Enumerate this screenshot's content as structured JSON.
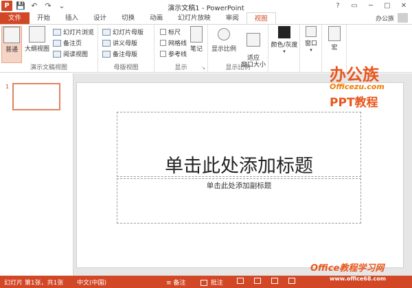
{
  "app": {
    "title": "演示文稿1 - PowerPoint",
    "logo": "P",
    "window_controls": [
      "?",
      "▭",
      "─",
      "□",
      "✕"
    ]
  },
  "qat": {
    "save_icon": "💾",
    "undo_icon": "↶",
    "redo_icon": "↷",
    "customize_icon": "⌄"
  },
  "tabs": [
    {
      "label": "文件"
    },
    {
      "label": "开始"
    },
    {
      "label": "插入"
    },
    {
      "label": "设计"
    },
    {
      "label": "切换"
    },
    {
      "label": "动画"
    },
    {
      "label": "幻灯片放映"
    },
    {
      "label": "审阅"
    },
    {
      "label": "视图"
    }
  ],
  "user": {
    "name": "办公族"
  },
  "ribbon": {
    "presentation_views": {
      "label": "演示文稿视图",
      "normal": "普通",
      "outline": "大纲视图",
      "slide_sorter": "幻灯片浏览",
      "notes_page": "备注页",
      "reading_view": "阅读视图"
    },
    "master_views": {
      "label": "母版视图",
      "slide_master": "幻灯片母版",
      "handout_master": "讲义母版",
      "notes_master": "备注母版"
    },
    "show": {
      "label": "显示",
      "ruler": "标尺",
      "gridlines": "网格线",
      "guides": "参考线",
      "notes": "笔记"
    },
    "zoom": {
      "label": "显示比例",
      "zoom": "显示比例",
      "fit_window": "适应\n窗口大小"
    },
    "color": {
      "label": "颜色/灰度"
    },
    "window": {
      "label": "窗口"
    },
    "macros": {
      "label": "宏"
    }
  },
  "thumbnails": {
    "slide_number": "1"
  },
  "slide": {
    "title_placeholder": "单击此处添加标题",
    "subtitle_placeholder": "单击此处添加副标题"
  },
  "watermark": {
    "brand_cn": "办公族",
    "brand_url": "Officezu.com",
    "ppt_label": "PPT教程",
    "bottom_brand": "Office教程学习网",
    "bottom_url": "www.office68.com"
  },
  "status": {
    "slide_info": "幻灯片 第1张，共1张",
    "language": "中文(中国)",
    "notes": "备注",
    "comments": "批注"
  },
  "colors": {
    "accent": "#d24726"
  }
}
